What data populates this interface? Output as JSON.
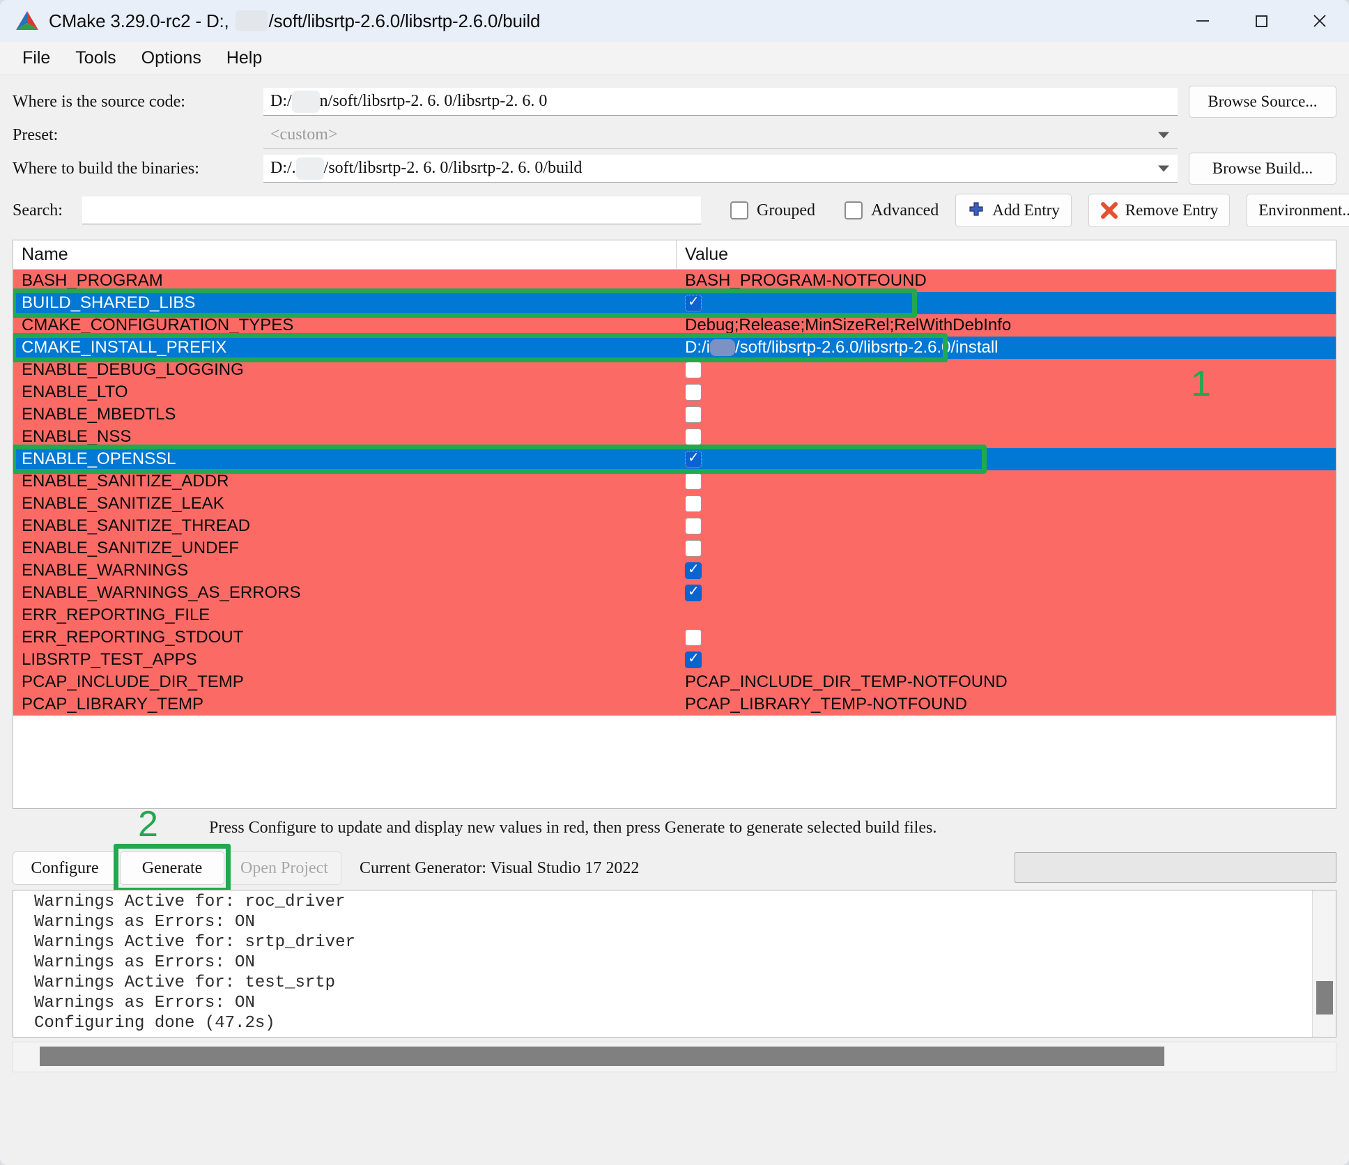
{
  "window": {
    "title": "CMake 3.29.0-rc2 - D:, ",
    "title_suffix": "/soft/libsrtp-2.6.0/libsrtp-2.6.0/build",
    "minimize_icon": "minimize-icon",
    "maximize_icon": "maximize-icon",
    "close_icon": "close-icon",
    "logo_icon": "cmake-logo-icon"
  },
  "menubar": {
    "items": [
      {
        "label": "File"
      },
      {
        "label": "Tools"
      },
      {
        "label": "Options"
      },
      {
        "label": "Help"
      }
    ]
  },
  "form": {
    "source_label": "Where is the source code:",
    "source_prefix": "D:/",
    "source_value": "n/soft/libsrtp-2. 6. 0/libsrtp-2. 6. 0",
    "browse_source_label": "Browse Source...",
    "preset_label": "Preset:",
    "preset_value": "<custom>",
    "build_label": "Where to build the binaries:",
    "build_prefix": "D:/.",
    "build_value": "/soft/libsrtp-2. 6. 0/libsrtp-2. 6. 0/build",
    "browse_build_label": "Browse Build..."
  },
  "search": {
    "label": "Search:",
    "value": "",
    "placeholder": "",
    "grouped_label": "Grouped",
    "grouped_checked": false,
    "advanced_label": "Advanced",
    "advanced_checked": false,
    "add_entry_label": "Add Entry",
    "add_entry_icon": "plus-icon",
    "remove_entry_label": "Remove Entry",
    "remove_entry_icon": "red-x-icon",
    "environment_label": "Environment..."
  },
  "table": {
    "columns": [
      "Name",
      "Value"
    ],
    "rows": [
      {
        "name": "BASH_PROGRAM",
        "value": "BASH_PROGRAM-NOTFOUND",
        "type": "text",
        "selected": false
      },
      {
        "name": "BUILD_SHARED_LIBS",
        "value": "",
        "type": "checkbox",
        "checked": true,
        "selected": true,
        "highlighted": true
      },
      {
        "name": "CMAKE_CONFIGURATION_TYPES",
        "value": "Debug;Release;MinSizeRel;RelWithDebInfo",
        "type": "text",
        "selected": false
      },
      {
        "name": "CMAKE_INSTALL_PREFIX",
        "value_prefix": "D:/i",
        "value": "/soft/libsrtp-2.6.0/libsrtp-2.6.0/install",
        "type": "redacted-text",
        "selected": true,
        "highlighted": true
      },
      {
        "name": "ENABLE_DEBUG_LOGGING",
        "value": "",
        "type": "checkbox",
        "checked": false,
        "selected": false
      },
      {
        "name": "ENABLE_LTO",
        "value": "",
        "type": "checkbox",
        "checked": false,
        "selected": false
      },
      {
        "name": "ENABLE_MBEDTLS",
        "value": "",
        "type": "checkbox",
        "checked": false,
        "selected": false
      },
      {
        "name": "ENABLE_NSS",
        "value": "",
        "type": "checkbox",
        "checked": false,
        "selected": false
      },
      {
        "name": "ENABLE_OPENSSL",
        "value": "",
        "type": "checkbox",
        "checked": true,
        "selected": true,
        "highlighted": true
      },
      {
        "name": "ENABLE_SANITIZE_ADDR",
        "value": "",
        "type": "checkbox",
        "checked": false,
        "selected": false
      },
      {
        "name": "ENABLE_SANITIZE_LEAK",
        "value": "",
        "type": "checkbox",
        "checked": false,
        "selected": false
      },
      {
        "name": "ENABLE_SANITIZE_THREAD",
        "value": "",
        "type": "checkbox",
        "checked": false,
        "selected": false
      },
      {
        "name": "ENABLE_SANITIZE_UNDEF",
        "value": "",
        "type": "checkbox",
        "checked": false,
        "selected": false
      },
      {
        "name": "ENABLE_WARNINGS",
        "value": "",
        "type": "checkbox",
        "checked": true,
        "selected": false
      },
      {
        "name": "ENABLE_WARNINGS_AS_ERRORS",
        "value": "",
        "type": "checkbox",
        "checked": true,
        "selected": false
      },
      {
        "name": "ERR_REPORTING_FILE",
        "value": "",
        "type": "empty",
        "selected": false
      },
      {
        "name": "ERR_REPORTING_STDOUT",
        "value": "",
        "type": "checkbox",
        "checked": false,
        "selected": false
      },
      {
        "name": "LIBSRTP_TEST_APPS",
        "value": "",
        "type": "checkbox",
        "checked": true,
        "selected": false
      },
      {
        "name": "PCAP_INCLUDE_DIR_TEMP",
        "value": "PCAP_INCLUDE_DIR_TEMP-NOTFOUND",
        "type": "text",
        "selected": false
      },
      {
        "name": "PCAP_LIBRARY_TEMP",
        "value": "PCAP_LIBRARY_TEMP-NOTFOUND",
        "type": "text",
        "selected": false
      }
    ]
  },
  "annotations": {
    "one": "1",
    "two": "2",
    "color": "#22a84f"
  },
  "status": {
    "text": "Press Configure to update and display new values in red, then press Generate to generate selected build files."
  },
  "actions": {
    "configure_label": "Configure",
    "generate_label": "Generate",
    "open_project_label": "Open Project",
    "generator_text": "Current Generator: Visual Studio 17 2022"
  },
  "log": {
    "lines": "Warnings Active for: roc_driver\nWarnings as Errors: ON\nWarnings Active for: srtp_driver\nWarnings as Errors: ON\nWarnings Active for: test_srtp\nWarnings as Errors: ON\nConfiguring done (47.2s)"
  },
  "colors": {
    "selected_row": "#0078d4",
    "modified_row": "#fc6a66",
    "highlight": "#22a84f",
    "checkbox_on": "#0b63ce"
  }
}
